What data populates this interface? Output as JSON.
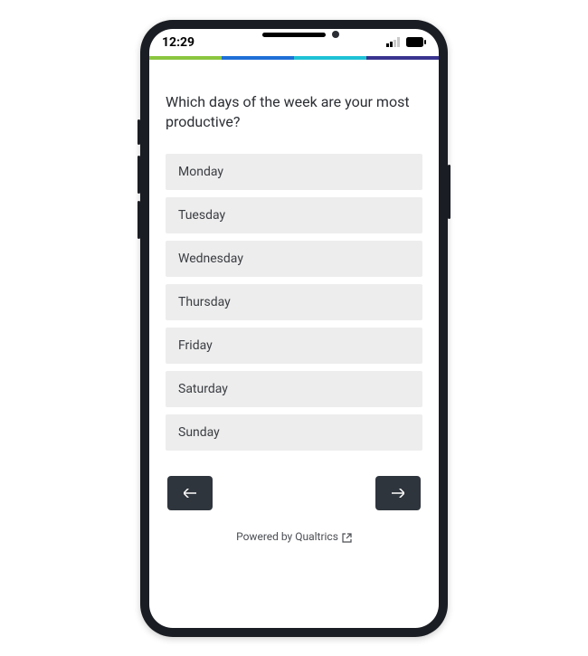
{
  "status": {
    "time": "12:29"
  },
  "progress_colors": [
    "#8bc63f",
    "#1f6fd6",
    "#1fc2d6",
    "#3a3490"
  ],
  "question": "Which days of the week are your most productive?",
  "options": [
    {
      "label": "Monday"
    },
    {
      "label": "Tuesday"
    },
    {
      "label": "Wednesday"
    },
    {
      "label": "Thursday"
    },
    {
      "label": "Friday"
    },
    {
      "label": "Saturday"
    },
    {
      "label": "Sunday"
    }
  ],
  "footer": {
    "text": "Powered by Qualtrics"
  }
}
